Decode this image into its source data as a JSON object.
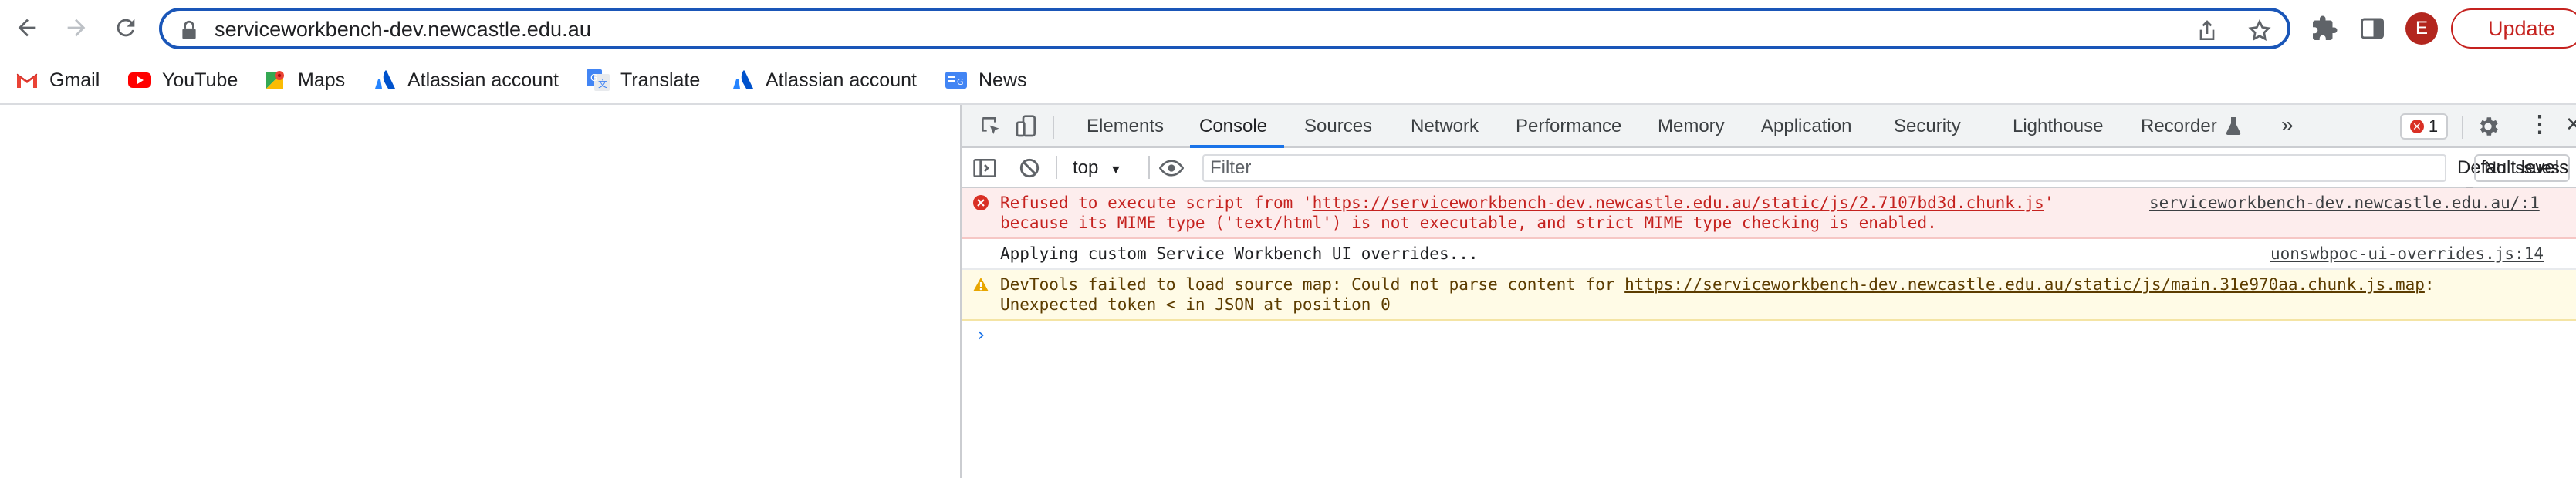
{
  "browser": {
    "url": "serviceworkbench-dev.newcastle.edu.au",
    "avatar_letter": "E",
    "update_label": "Update"
  },
  "bookmarks": [
    {
      "label": "Gmail",
      "icon": "gmail-icon"
    },
    {
      "label": "YouTube",
      "icon": "youtube-icon"
    },
    {
      "label": "Maps",
      "icon": "maps-icon"
    },
    {
      "label": "Atlassian account",
      "icon": "atlassian-icon"
    },
    {
      "label": "Translate",
      "icon": "translate-icon"
    },
    {
      "label": "Atlassian account",
      "icon": "atlassian-icon"
    },
    {
      "label": "News",
      "icon": "news-icon"
    }
  ],
  "devtools": {
    "tabs": [
      {
        "label": "Elements"
      },
      {
        "label": "Console",
        "active": true
      },
      {
        "label": "Sources"
      },
      {
        "label": "Network"
      },
      {
        "label": "Performance"
      },
      {
        "label": "Memory"
      },
      {
        "label": "Application"
      },
      {
        "label": "Security"
      },
      {
        "label": "Lighthouse"
      },
      {
        "label": "Recorder"
      }
    ],
    "error_count": "1",
    "context": "top",
    "filter_placeholder": "Filter",
    "levels_label": "Default levels",
    "issues_label": "No Issues",
    "messages": {
      "error": {
        "line1_prefix": "Refused to execute script from '",
        "line1_link": "https://serviceworkbench-dev.newcastle.edu.au/static/js/2.7107bd3d.chunk.js",
        "line1_suffix": "'",
        "line2": "because its MIME type ('text/html') is not executable, and strict MIME type checking is enabled.",
        "source": "serviceworkbench-dev.newcastle.edu.au/:1"
      },
      "log": {
        "text": "Applying custom Service Workbench UI overrides...",
        "source": "uonswbpoc-ui-overrides.js:14"
      },
      "warn": {
        "line1_prefix": "DevTools failed to load source map: Could not parse content for ",
        "line1_link": "https://serviceworkbench-dev.newcastle.edu.au/static/js/main.31e970aa.chunk.js.map",
        "line1_suffix": ":",
        "line2": "Unexpected token < in JSON at position 0"
      }
    },
    "prompt": "›"
  },
  "colors": {
    "accent": "#1a73e8",
    "omnibox_border": "#1a56b8",
    "error": "#c5221f",
    "update": "#c5221f"
  }
}
